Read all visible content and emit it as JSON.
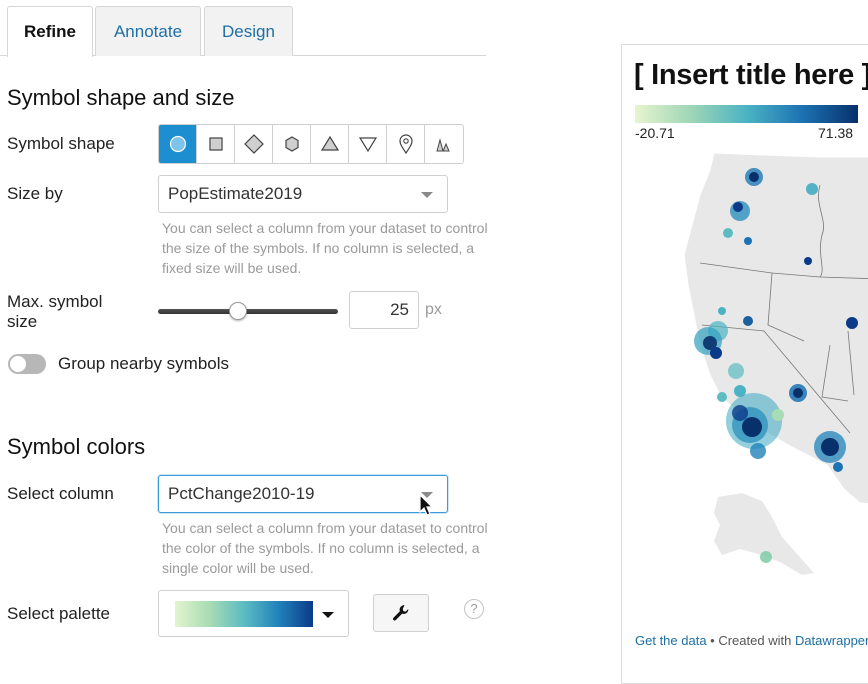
{
  "tabs": [
    {
      "label": "Refine"
    },
    {
      "label": "Annotate"
    },
    {
      "label": "Design"
    }
  ],
  "symbol_section": {
    "heading": "Symbol shape and size",
    "shape_label": "Symbol shape",
    "shapes": [
      "circle-icon",
      "square-icon",
      "diamond-icon",
      "hexagon-icon",
      "triangle-icon",
      "triangle-down-icon",
      "marker-pin-icon",
      "spikes-icon"
    ],
    "selected_shape": "circle-icon",
    "size_label": "Size by",
    "size_value": "PopEstimate2019",
    "size_help": "You can select a column from your dataset to control the size of the symbols. If no column is selected, a fixed size will be used.",
    "max_size_label": "Max. symbol size",
    "max_size_value": "25",
    "max_size_unit": "px",
    "max_size_slider_level": 0.45,
    "group_label": "Group nearby symbols",
    "group_enabled": false
  },
  "color_section": {
    "heading": "Symbol colors",
    "column_label": "Select column",
    "column_value": "PctChange2010-19",
    "column_help": "You can select a column from your dataset to control the color of the symbols. If no column is selected, a single color will be used.",
    "palette_label": "Select palette",
    "palette_colors": [
      "#e3f4cf",
      "#a8dcb4",
      "#5cbcc2",
      "#2183ba",
      "#0b3a88"
    ],
    "help_mark": "?"
  },
  "preview": {
    "title": "[ Insert title here ]",
    "legend_min": "-20.71",
    "legend_max": "71.38",
    "footer_link_1": "Get the data",
    "footer_sep": " • Created with ",
    "footer_link_2": "Datawrapper"
  },
  "colors": {
    "accent": "#1d8fd1",
    "link": "#1d6fa5"
  }
}
